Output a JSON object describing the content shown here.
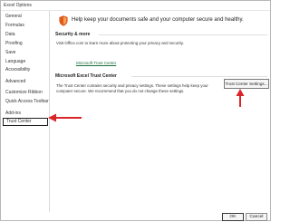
{
  "window": {
    "title": "Excel Options"
  },
  "sidebar": {
    "items": [
      {
        "label": "General"
      },
      {
        "label": "Formulas"
      },
      {
        "label": "Data"
      },
      {
        "label": "Proofing"
      },
      {
        "label": "Save"
      },
      {
        "label": "Language"
      },
      {
        "label": "Accessibility"
      },
      {
        "label": "Advanced"
      },
      {
        "label": "Customize Ribbon"
      },
      {
        "label": "Quick Access Toolbar"
      },
      {
        "label": "Add-ins"
      },
      {
        "label": "Trust Center"
      }
    ],
    "selected_index": 11
  },
  "main": {
    "header": "Help keep your documents safe and your computer secure and healthy.",
    "security": {
      "heading": "Security & more",
      "text": "Visit Office.com to learn more about protecting your privacy and security.",
      "link": "Microsoft Trust Center"
    },
    "trust_center": {
      "heading": "Microsoft Excel Trust Center",
      "text_line1": "The Trust Center contains security and privacy settings. These settings help keep your",
      "text_line2": "computer secure. We recommend that you do not change these settings.",
      "button_label": "Trust Center Settings..."
    }
  },
  "footer": {
    "ok_label": "OK",
    "cancel_label": "Cancel"
  },
  "colors": {
    "annotation_arrow": "#d9252a",
    "shield": "#e05a1c",
    "link": "#1f6f3d"
  },
  "icons": {
    "header": "shield-icon"
  }
}
